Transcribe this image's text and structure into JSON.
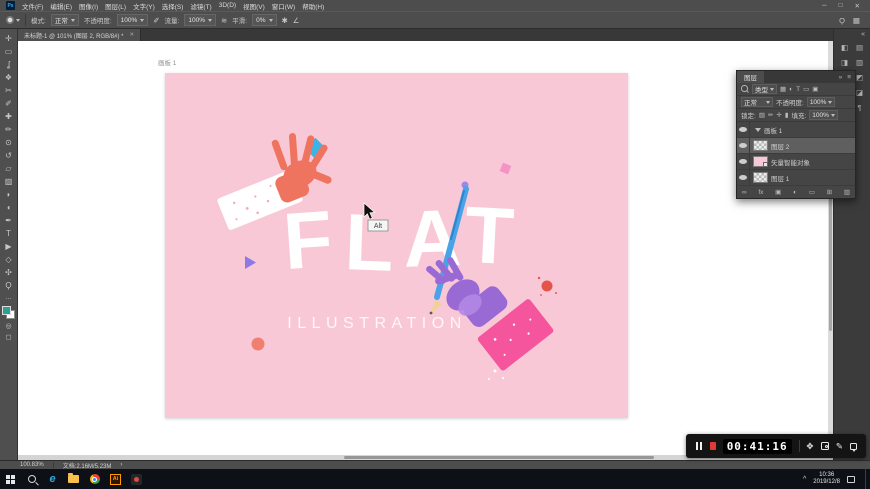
{
  "menubar": {
    "logo": "Ps",
    "items": [
      "文件(F)",
      "编辑(E)",
      "图像(I)",
      "图层(L)",
      "文字(Y)",
      "选择(S)",
      "滤镜(T)",
      "3D(D)",
      "视图(V)",
      "窗口(W)",
      "帮助(H)"
    ],
    "minimize": "─",
    "maximize": "□",
    "close": "✕"
  },
  "options_bar": {
    "mode_label": "模式:",
    "mode_value": "正常",
    "opacity_label": "不透明度:",
    "opacity_value": "100%",
    "flow_label": "流量:",
    "flow_value": "100%",
    "smoothing_label": "平滑:",
    "smoothing_value": "0%",
    "icons": {
      "pressure": "✐",
      "airbrush": "≋",
      "gear": "✱",
      "angle": "∠",
      "search": "Ϙ",
      "workspace": "▦"
    }
  },
  "doc_tab": {
    "title": "未标题-1 @ 101% (图层 2, RGB/8#) *",
    "close_icon": "✕"
  },
  "toolbar": {
    "tools": [
      {
        "name": "move-tool",
        "glyph": "✛"
      },
      {
        "name": "marquee-tool",
        "glyph": "▭"
      },
      {
        "name": "lasso-tool",
        "glyph": "ʆ"
      },
      {
        "name": "quick-selection-tool",
        "glyph": "❖"
      },
      {
        "name": "crop-tool",
        "glyph": "✂"
      },
      {
        "name": "eyedropper-tool",
        "glyph": "✐"
      },
      {
        "name": "healing-brush-tool",
        "glyph": "✚"
      },
      {
        "name": "brush-tool",
        "glyph": "✏"
      },
      {
        "name": "clone-stamp-tool",
        "glyph": "⊙"
      },
      {
        "name": "history-brush-tool",
        "glyph": "↺"
      },
      {
        "name": "eraser-tool",
        "glyph": "▱"
      },
      {
        "name": "gradient-tool",
        "glyph": "▨"
      },
      {
        "name": "blur-tool",
        "glyph": "◗"
      },
      {
        "name": "dodge-tool",
        "glyph": "◖"
      },
      {
        "name": "pen-tool",
        "glyph": "✒"
      },
      {
        "name": "type-tool",
        "glyph": "T"
      },
      {
        "name": "path-selection-tool",
        "glyph": "▶"
      },
      {
        "name": "shape-tool",
        "glyph": "◇"
      },
      {
        "name": "hand-tool",
        "glyph": "✣"
      },
      {
        "name": "zoom-tool",
        "glyph": "Ϙ"
      }
    ],
    "more": "…",
    "quick_mask": "◎",
    "screen_mode": "◻"
  },
  "canvas": {
    "artboard_label": "画板 1",
    "title_letters": [
      "F",
      "L",
      "A",
      "T"
    ],
    "subtitle": "ILLUSTRATION",
    "tooltip": "Alt",
    "colors": {
      "background": "#f9c8d6",
      "hand_top": "#ef745f",
      "hand_bottom": "#9a6ad4",
      "sleeve_bottom": "#f4559c",
      "pencil": "#4aa3e8",
      "diamond": "#3cb4e7"
    }
  },
  "right_dock": {
    "collapse": "«",
    "icons": [
      {
        "name": "color-panel",
        "glyph": "◧"
      },
      {
        "name": "swatches-panel",
        "glyph": "▤"
      },
      {
        "name": "gradients-panel",
        "glyph": "◨"
      },
      {
        "name": "patterns-panel",
        "glyph": "▥"
      },
      {
        "name": "libraries-panel",
        "glyph": "▦"
      },
      {
        "name": "adjustments-panel",
        "glyph": "◩"
      },
      {
        "name": "history-panel",
        "glyph": "↺"
      },
      {
        "name": "properties-panel",
        "glyph": "◪"
      },
      {
        "name": "info-panel",
        "glyph": "i"
      },
      {
        "name": "paragraph-panel",
        "glyph": "¶"
      }
    ]
  },
  "layers_panel": {
    "title": "图层",
    "collapse_icon": "»",
    "menu_icon": "≡",
    "filter_label": "类型",
    "filter_icons": [
      {
        "name": "pixel-layer-filter",
        "glyph": "▦"
      },
      {
        "name": "adjustment-layer-filter",
        "glyph": "◐"
      },
      {
        "name": "type-layer-filter",
        "glyph": "T"
      },
      {
        "name": "shape-layer-filter",
        "glyph": "▭"
      },
      {
        "name": "smart-object-filter",
        "glyph": "▣"
      }
    ],
    "blend_mode": "正常",
    "opacity_label": "不透明度:",
    "opacity_value": "100%",
    "lock_label": "锁定:",
    "lock_icons": [
      {
        "name": "lock-transparent-pixels",
        "glyph": "▨"
      },
      {
        "name": "lock-image-pixels",
        "glyph": "✏"
      },
      {
        "name": "lock-position",
        "glyph": "✛"
      },
      {
        "name": "lock-artboard-nesting",
        "glyph": "⊞"
      },
      {
        "name": "lock-all",
        "glyph": "▮"
      }
    ],
    "fill_label": "填充:",
    "fill_value": "100%",
    "layers": [
      {
        "name": "画板 1",
        "type": "artboard",
        "selected": false
      },
      {
        "name": "图层 2",
        "type": "pixel",
        "selected": true
      },
      {
        "name": "矢量智能对象",
        "type": "smart-object",
        "selected": false
      },
      {
        "name": "图层 1",
        "type": "pixel",
        "selected": false
      }
    ],
    "bottom_icons": [
      {
        "name": "link-layers",
        "glyph": "∞"
      },
      {
        "name": "layer-style",
        "glyph": "fx"
      },
      {
        "name": "layer-mask",
        "glyph": "▣"
      },
      {
        "name": "adjustment-layer",
        "glyph": "◐"
      },
      {
        "name": "layer-group",
        "glyph": "▭"
      },
      {
        "name": "new-layer",
        "glyph": "⊞"
      },
      {
        "name": "delete-layer",
        "glyph": "▥"
      }
    ]
  },
  "status_bar": {
    "zoom": "100.83%",
    "doc_label": "文档:2.16M/5.23M",
    "chevron": "›"
  },
  "recorder": {
    "time": "00:41:16",
    "icons": {
      "move": "✥",
      "pen": "✎"
    }
  },
  "taskbar": {
    "tray_expand": "^",
    "edge_letter": "e",
    "ai_label": "Ai",
    "time": "10:36",
    "date": "2019/12/8"
  }
}
